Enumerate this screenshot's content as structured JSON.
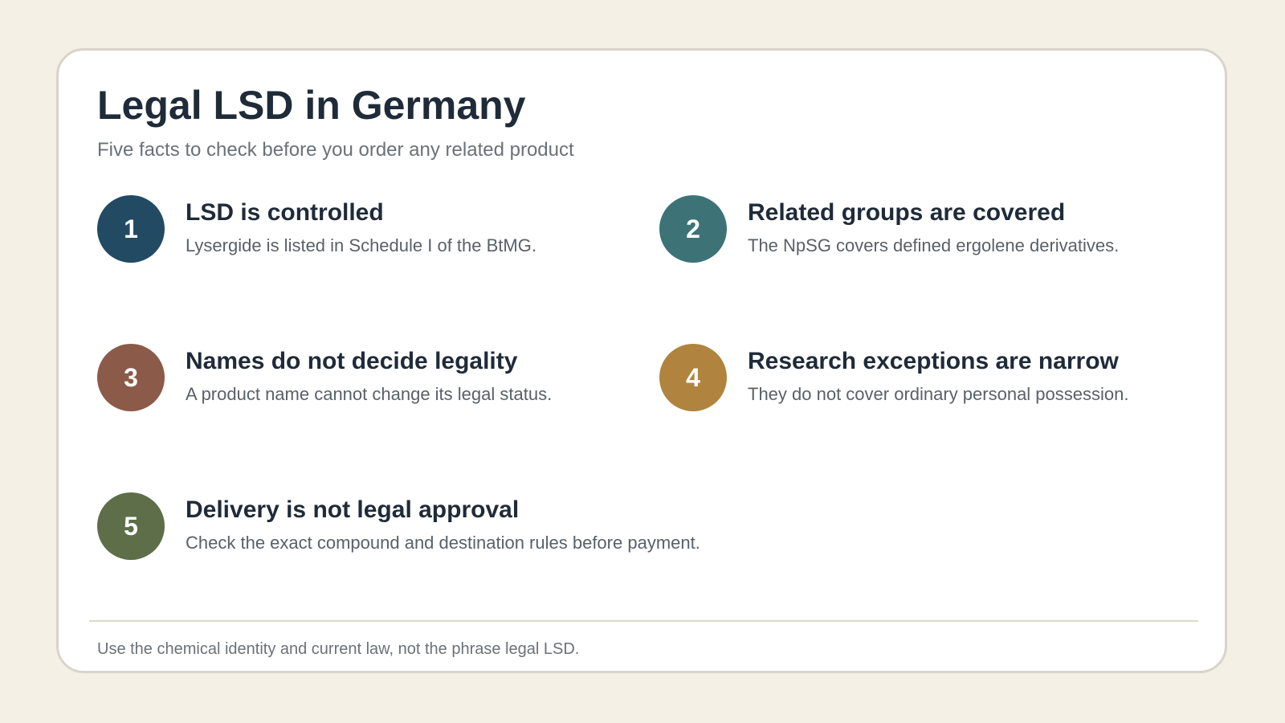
{
  "header": {
    "title": "Legal LSD in Germany",
    "subtitle": "Five facts to check before you order any related product"
  },
  "facts": [
    {
      "number": "1",
      "title": "LSD is controlled",
      "description": "Lysergide is listed in Schedule I of the BtMG.",
      "color": "#234a63"
    },
    {
      "number": "2",
      "title": "Related groups are covered",
      "description": "The NpSG covers defined ergolene derivatives.",
      "color": "#3d7376"
    },
    {
      "number": "3",
      "title": "Names do not decide legality",
      "description": "A product name cannot change its legal status.",
      "color": "#8c5a48"
    },
    {
      "number": "4",
      "title": "Research exceptions are narrow",
      "description": "They do not cover ordinary personal possession.",
      "color": "#b0843e"
    },
    {
      "number": "5",
      "title": "Delivery is not legal approval",
      "description": "Check the exact compound and destination rules before payment.",
      "color": "#5d6e48"
    }
  ],
  "footer": {
    "note": "Use the chemical identity and current law, not the phrase legal LSD."
  }
}
